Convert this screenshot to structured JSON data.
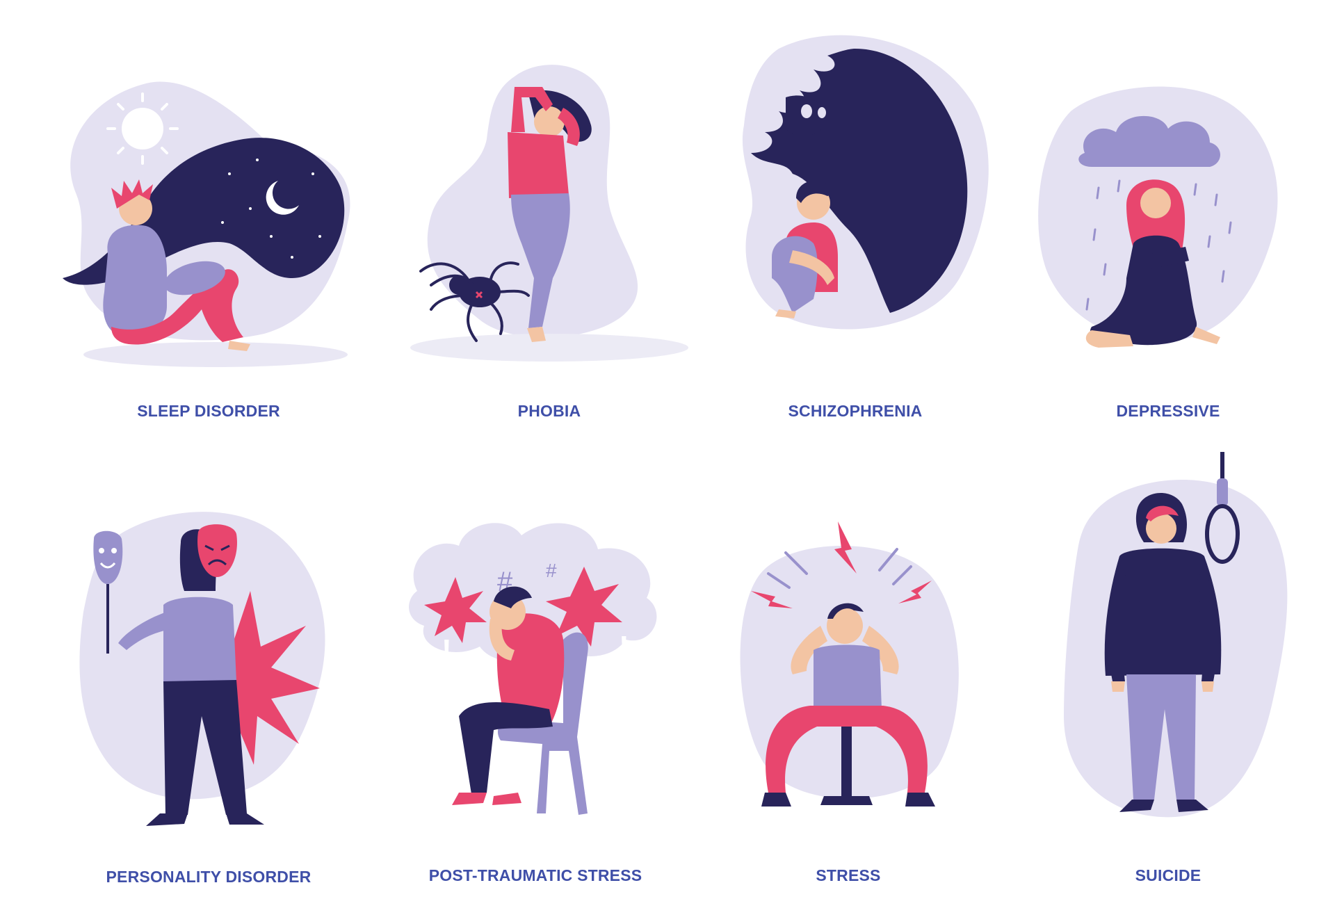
{
  "colors": {
    "navy": "#28245a",
    "pink": "#e8466e",
    "lavender": "#9891cc",
    "cloud": "#e4e1f2",
    "skin": "#f3c4a3",
    "label": "#3f4fa8"
  },
  "cards": [
    {
      "label": "SLEEP DISORDER",
      "icon": "sleep-disorder-illustration"
    },
    {
      "label": "PHOBIA",
      "icon": "phobia-illustration"
    },
    {
      "label": "SCHIZOPHRENIA",
      "icon": "schizophrenia-illustration"
    },
    {
      "label": "DEPRESSIVE",
      "icon": "depressive-illustration"
    },
    {
      "label": "PERSONALITY DISORDER",
      "icon": "personality-disorder-illustration"
    },
    {
      "label": "POST-TRAUMATIC STRESS",
      "icon": "post-traumatic-stress-illustration"
    },
    {
      "label": "STRESS",
      "icon": "stress-illustration"
    },
    {
      "label": "SUICIDE",
      "icon": "suicide-illustration"
    }
  ]
}
